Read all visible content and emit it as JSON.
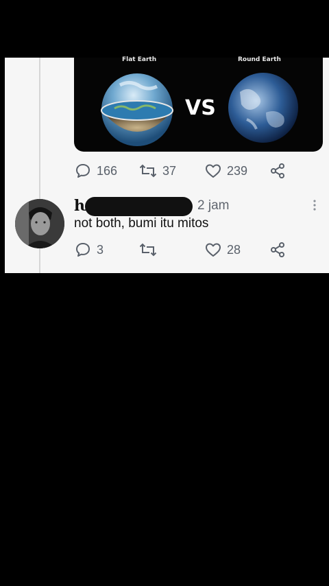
{
  "media": {
    "left_label": "Flat Earth",
    "right_label": "Round Earth",
    "vs_text": "VS"
  },
  "tweet": {
    "replies": "166",
    "retweets": "37",
    "likes": "239"
  },
  "reply": {
    "name_prefix": "ƕ",
    "time": "2 jam",
    "text": "not both, bumi itu mitos",
    "replies": "3",
    "retweets": "",
    "likes": "28"
  },
  "colors": {
    "card": "#f6f6f6",
    "icon": "#59606a",
    "background": "#000000"
  },
  "icons": [
    "reply-icon",
    "retweet-icon",
    "like-icon",
    "share-icon",
    "more-options-icon"
  ]
}
